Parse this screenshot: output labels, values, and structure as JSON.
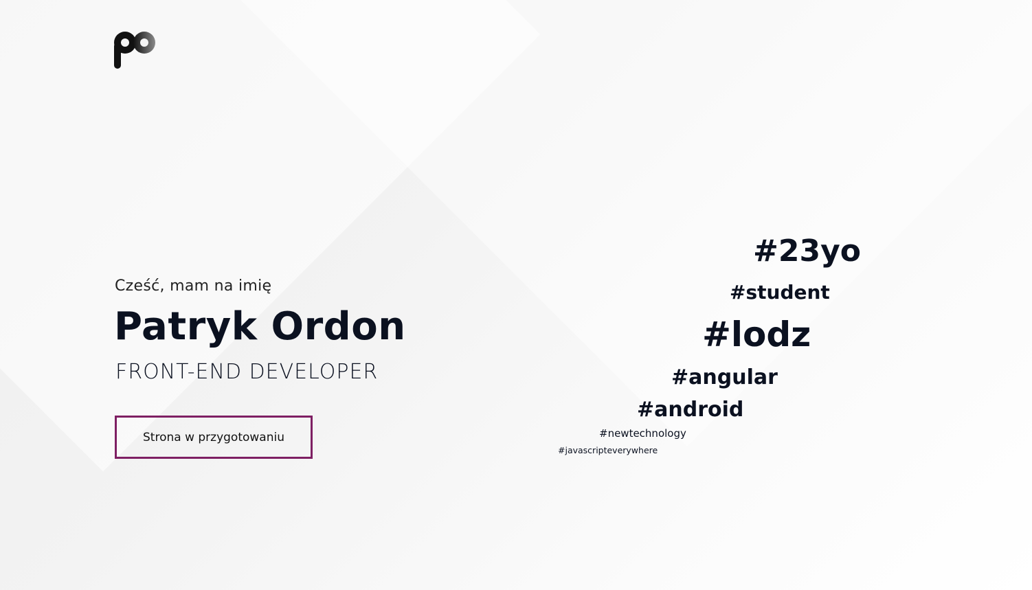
{
  "brand": {
    "logo_text": "po"
  },
  "hero": {
    "greeting": "Cześć, mam na imię",
    "name": "Patryk Ordon",
    "role": "FRONT-END DEVELOPER",
    "cta_label": "Strona w przygotowaniu"
  },
  "tags": [
    "#23yo",
    "#student",
    "#lodz",
    "#angular",
    "#android",
    "#newtechnology",
    "#javascripteverywhere"
  ],
  "colors": {
    "accent": "#7e1f63",
    "text": "#0b1120",
    "background": "#f3f3f3"
  }
}
